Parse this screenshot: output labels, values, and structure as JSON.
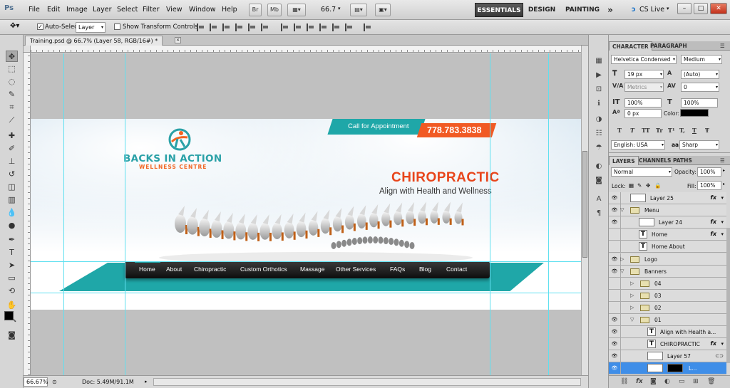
{
  "app": {
    "logo": "Ps",
    "menu": [
      "File",
      "Edit",
      "Image",
      "Layer",
      "Select",
      "Filter",
      "View",
      "Window",
      "Help"
    ],
    "bridge_btn": "Br",
    "minibridge_btn": "Mb",
    "zoom_value": "66.7",
    "workspaces": [
      "ESSENTIALS",
      "DESIGN",
      "PAINTING"
    ],
    "more_workspaces": "»",
    "cs_live": "CS Live"
  },
  "options": {
    "auto_select_label": "Auto-Select:",
    "auto_select_value": "Layer",
    "transform_label": "Show Transform Controls"
  },
  "document": {
    "tab_title": "Training.psd @ 66.7% (Layer 58, RGB/16#) *",
    "close": "×"
  },
  "banner": {
    "logo_line1": "BACKS IN ACTION",
    "logo_line2": "WELLNESS CENTRE",
    "appointment_label": "Call for Appointment",
    "phone": "778.783.3838",
    "headline": "CHIROPRACTIC",
    "subheadline": "Align with Health and Wellness",
    "nav": [
      "Home",
      "About",
      "Chiropractic",
      "Custom Orthotics",
      "Massage",
      "Other Services",
      "FAQs",
      "Blog",
      "Contact"
    ],
    "colors": {
      "teal": "#1fa7a8",
      "orange": "#f15a24",
      "headline_red": "#e8451b"
    }
  },
  "status": {
    "zoom": "66.67%",
    "doc_info": "Doc: 5.49M/91.1M"
  },
  "character": {
    "tabs": [
      "CHARACTER",
      "PARAGRAPH"
    ],
    "font_family": "Helvetica Condensed",
    "font_style": "Medium",
    "font_size": "19 px",
    "leading": "(Auto)",
    "kerning": "Metrics",
    "tracking": "0",
    "vertical_scale": "100%",
    "horizontal_scale": "100%",
    "baseline_shift": "0 px",
    "color_label": "Color:",
    "type_buttons": [
      "T",
      "T",
      "TT",
      "Tr",
      "T¹",
      "T,",
      "T",
      "Ŧ"
    ],
    "language": "English: USA",
    "aa_label": "aa",
    "antialias": "Sharp"
  },
  "layers": {
    "tabs": [
      "LAYERS",
      "CHANNELS",
      "PATHS"
    ],
    "blend_mode": "Normal",
    "opacity_label": "Opacity:",
    "opacity": "100%",
    "lock_label": "Lock:",
    "fill_label": "Fill:",
    "fill": "100%",
    "fx": "fx",
    "rows": [
      {
        "name": "Layer 25",
        "kind": "thumb",
        "fx": true
      },
      {
        "name": "Menu",
        "kind": "folder",
        "open": true
      },
      {
        "name": "Layer 24",
        "kind": "thumb",
        "fx": true
      },
      {
        "name": "Home",
        "kind": "text",
        "fx": true
      },
      {
        "name": "Home       About",
        "kind": "text"
      },
      {
        "name": "Logo",
        "kind": "folder",
        "open": false
      },
      {
        "name": "Banners",
        "kind": "folder",
        "open": true
      },
      {
        "name": "04",
        "kind": "folder",
        "open": false
      },
      {
        "name": "03",
        "kind": "folder",
        "open": false
      },
      {
        "name": "02",
        "kind": "folder",
        "open": false
      },
      {
        "name": "01",
        "kind": "folder",
        "open": true
      },
      {
        "name": "Align with Health a...",
        "kind": "text"
      },
      {
        "name": "CHIROPRACTIC",
        "kind": "text",
        "fx": true
      },
      {
        "name": "Layer 57",
        "kind": "thumb"
      },
      {
        "name": "L...",
        "kind": "mask",
        "selected": true
      }
    ]
  }
}
